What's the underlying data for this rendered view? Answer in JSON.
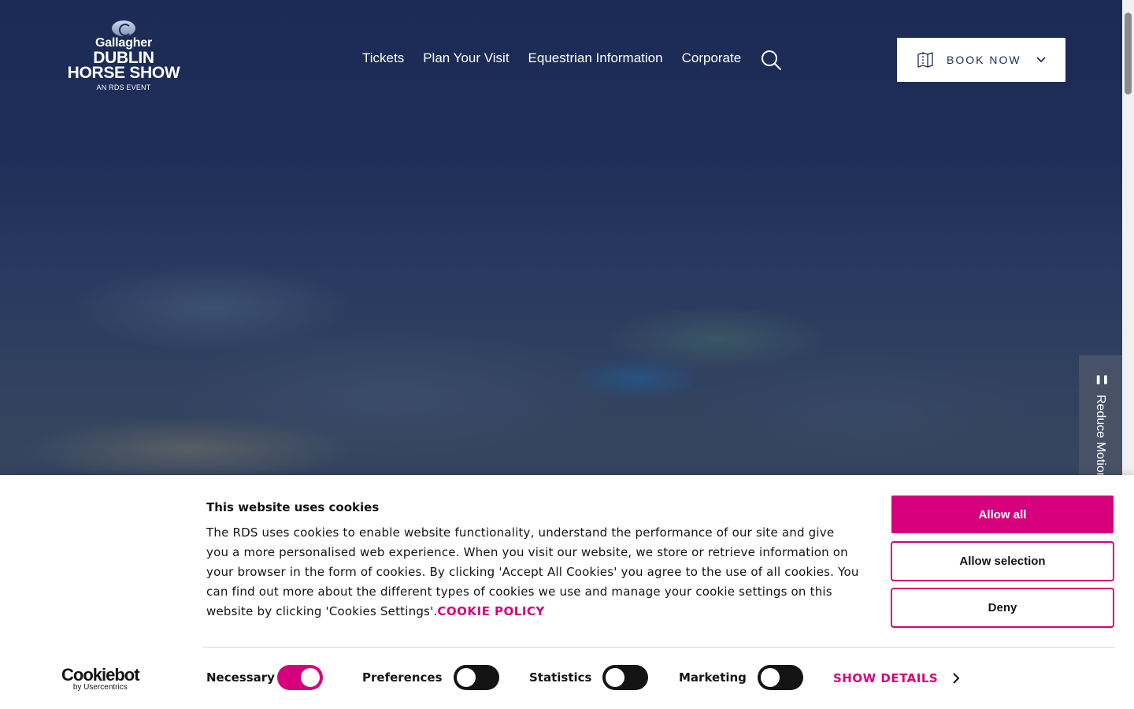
{
  "header": {
    "logo": {
      "brand_small": "Gallagher",
      "brand_line1": "DUBLIN",
      "brand_line2": "HORSE SHOW",
      "brand_sub": "AN RDS EVENT"
    },
    "nav": [
      {
        "label": "Tickets"
      },
      {
        "label": "Plan Your Visit"
      },
      {
        "label": "Equestrian Information"
      },
      {
        "label": "Corporate"
      }
    ],
    "search_icon": "search-icon",
    "book_now": {
      "label": "BOOK NOW",
      "icon": "ticket-icon"
    }
  },
  "reduce_motion": {
    "label": "Reduce Motion",
    "icon": "pause-icon"
  },
  "cookie_banner": {
    "title": "This website uses cookies",
    "body": "The RDS uses cookies to enable website functionality, understand the performance of our site and give you a more personalised web experience. When you visit our website, we store or retrieve information on your browser in the form of cookies. By clicking 'Accept All Cookies' you agree to the use of all cookies. You can find out more about the different types of cookies we use and manage your cookie settings on this website by clicking 'Cookies Settings'.",
    "policy_link": "COOKIE POLICY",
    "buttons": {
      "allow_all": "Allow all",
      "allow_selection": "Allow selection",
      "deny": "Deny"
    },
    "cookiebot": {
      "name": "Cookiebot",
      "by": "by Usercentrics"
    },
    "toggles": [
      {
        "label": "Necessary",
        "state": "on"
      },
      {
        "label": "Preferences",
        "state": "off"
      },
      {
        "label": "Statistics",
        "state": "off"
      },
      {
        "label": "Marketing",
        "state": "off"
      }
    ],
    "show_details": "SHOW DETAILS"
  },
  "colors": {
    "accent": "#d6007c",
    "navy": "#1b2b55",
    "toggle_off": "#141414"
  }
}
